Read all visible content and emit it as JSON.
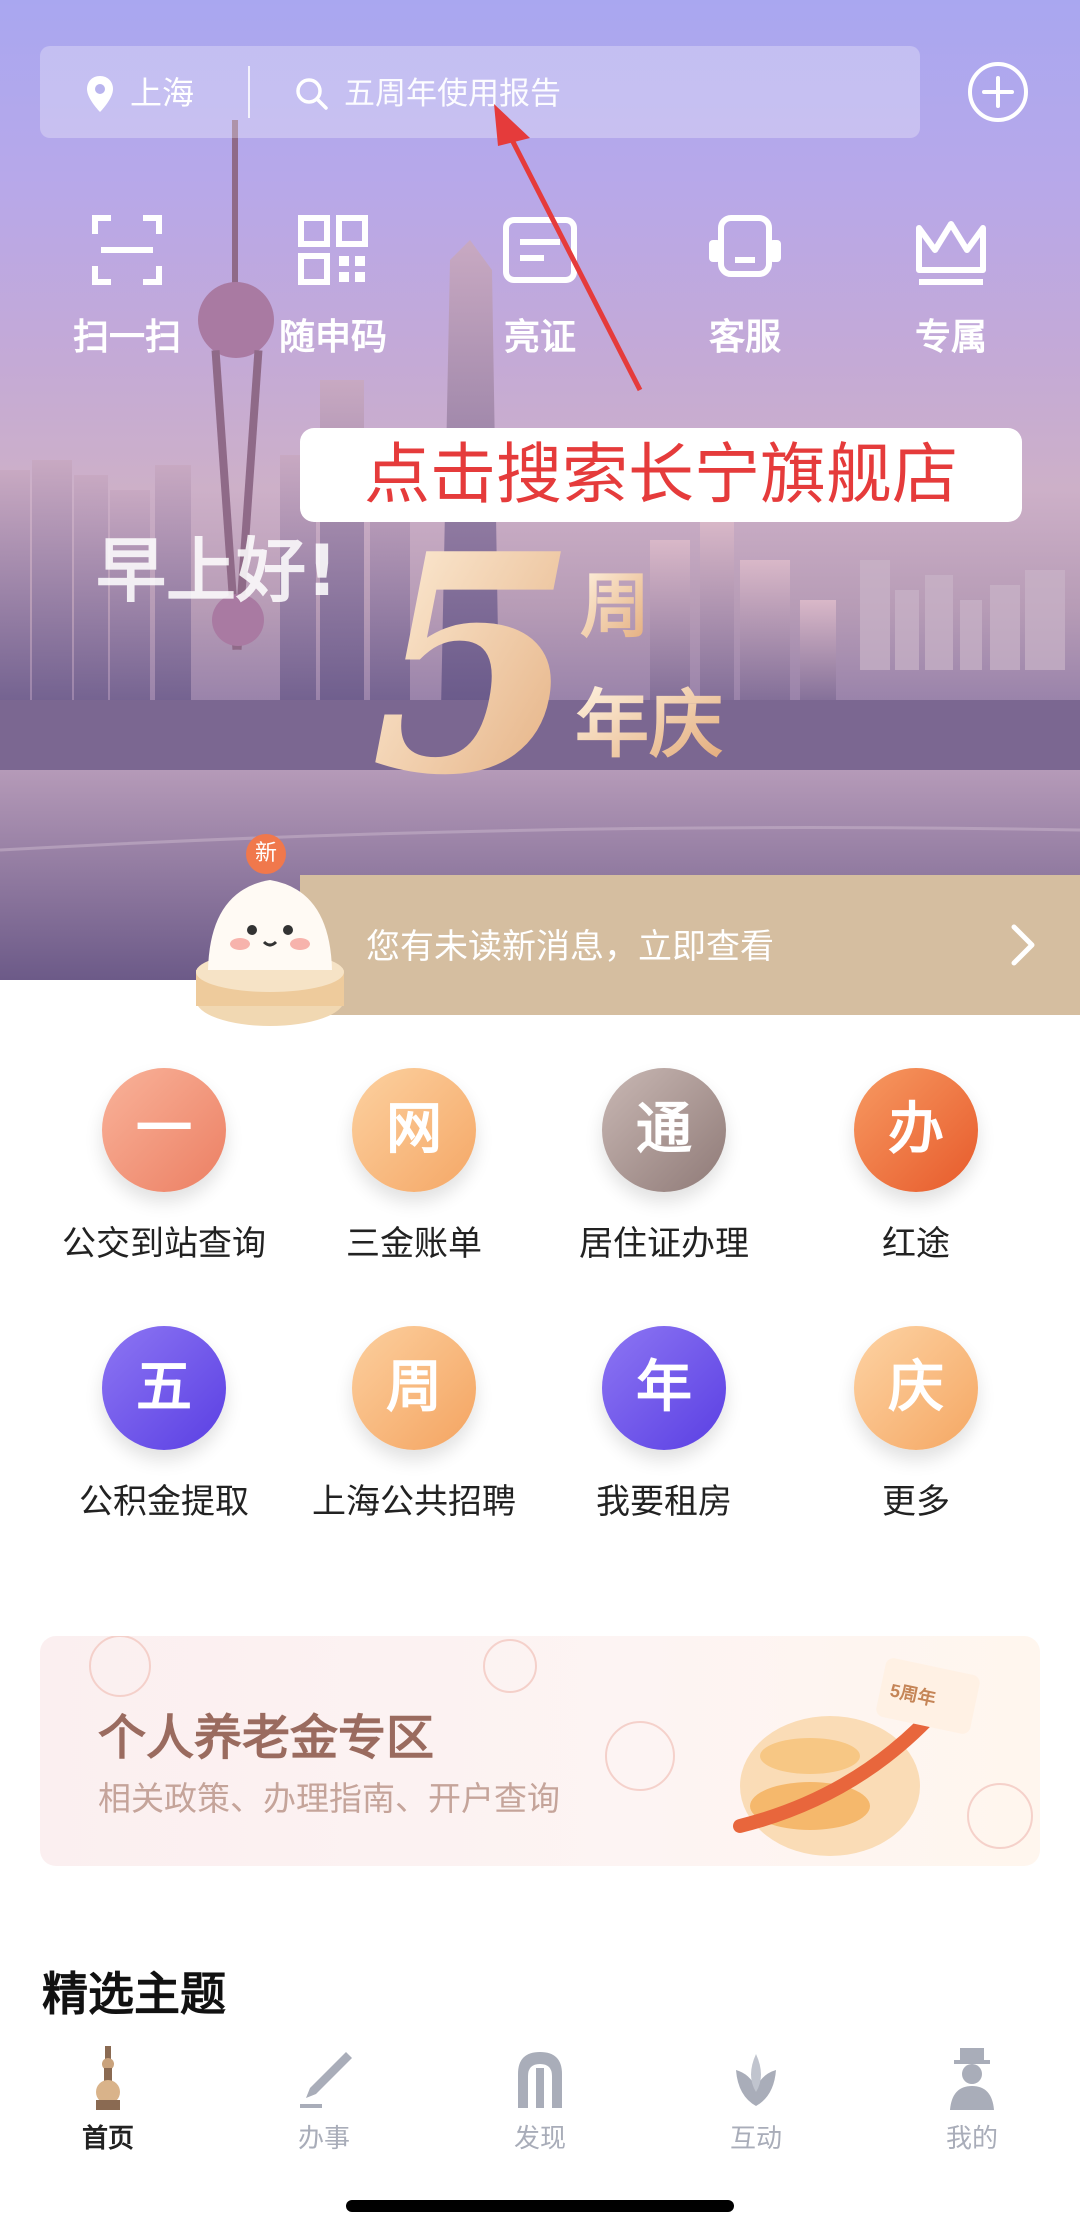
{
  "header": {
    "location": "上海",
    "search_placeholder": "五周年使用报告",
    "plus_icon": "plus-circle-icon"
  },
  "quick_actions": [
    {
      "label": "扫一扫",
      "icon": "scan-icon"
    },
    {
      "label": "随申码",
      "icon": "qr-code-icon"
    },
    {
      "label": "亮证",
      "icon": "id-card-icon"
    },
    {
      "label": "客服",
      "icon": "headset-icon"
    },
    {
      "label": "专属",
      "icon": "crown-icon"
    }
  ],
  "annotation": "点击搜索长宁旗舰店",
  "greeting": "早上好!",
  "anniversary": {
    "number": "5",
    "line1": "周",
    "line2": "年庆"
  },
  "message_bar": {
    "badge": "新",
    "text": "您有未读新消息，立即查看"
  },
  "services": [
    {
      "glyph": "一",
      "label": "公交到站查询",
      "color": "#ef8c6f"
    },
    {
      "glyph": "网",
      "label": "三金账单",
      "color": "#f7b47a"
    },
    {
      "glyph": "通",
      "label": "居住证办理",
      "color": "#a38f8c"
    },
    {
      "glyph": "办",
      "label": "红途",
      "color": "#ef6f3b"
    },
    {
      "glyph": "五",
      "label": "公积金提取",
      "color": "#6e52ea"
    },
    {
      "glyph": "周",
      "label": "上海公共招聘",
      "color": "#f8b279"
    },
    {
      "glyph": "年",
      "label": "我要租房",
      "color": "#6e52ea"
    },
    {
      "glyph": "庆",
      "label": "更多",
      "color": "#f9b67c"
    }
  ],
  "banner": {
    "title": "个人养老金专区",
    "subtitle": "相关政策、办理指南、开户查询",
    "badge_text": "5周年"
  },
  "section_title": "精选主题",
  "tabs": [
    {
      "label": "首页",
      "icon": "pagoda-icon",
      "active": true
    },
    {
      "label": "办事",
      "icon": "pen-icon",
      "active": false
    },
    {
      "label": "发现",
      "icon": "arch-icon",
      "active": false
    },
    {
      "label": "互动",
      "icon": "magnolia-icon",
      "active": false
    },
    {
      "label": "我的",
      "icon": "person-icon",
      "active": false
    }
  ]
}
